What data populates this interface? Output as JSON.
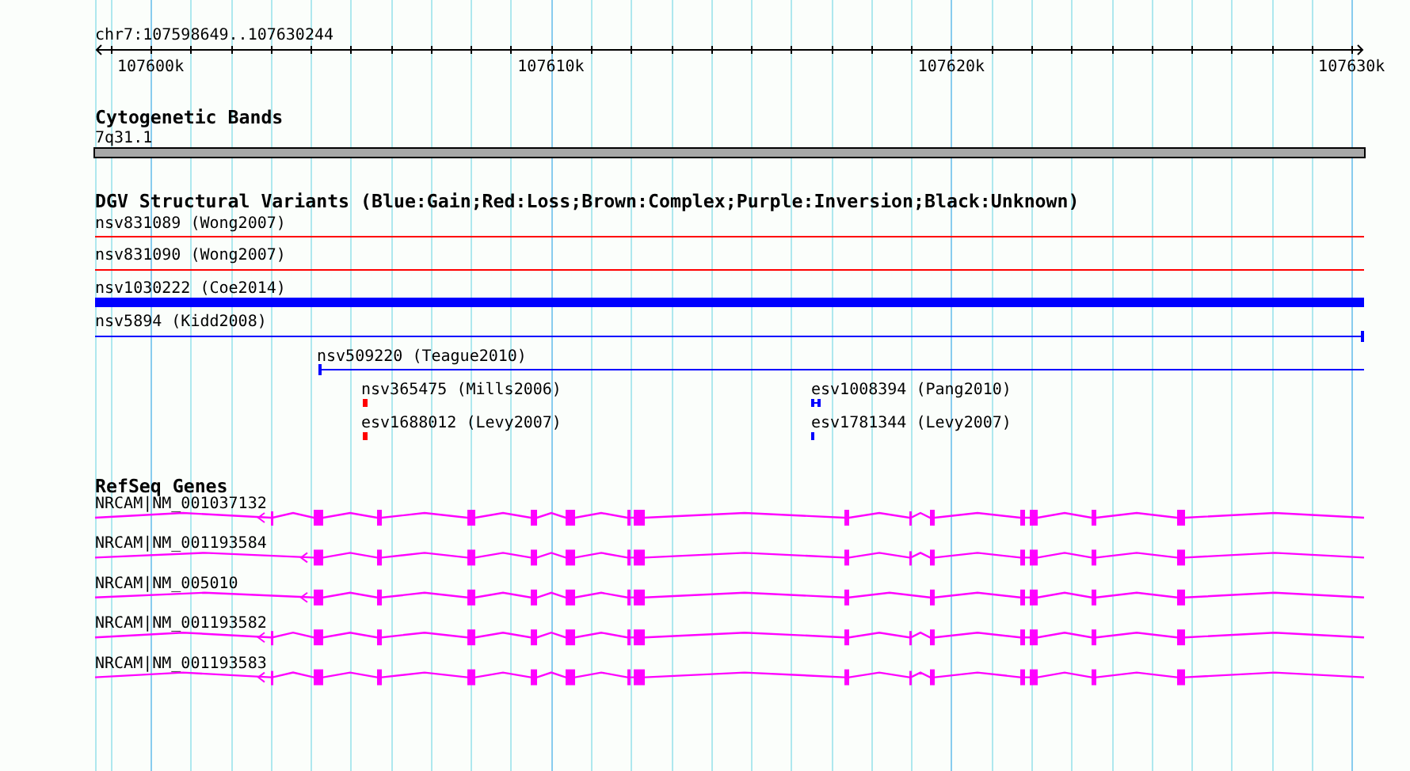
{
  "ruler": {
    "region": "chr7:107598649..107630244",
    "tick_labels": [
      "107600k",
      "107610k",
      "107620k",
      "107630k"
    ]
  },
  "cytogenetic_bands": {
    "title": "Cytogenetic Bands",
    "band": "7q31.1"
  },
  "dgv": {
    "title": "DGV Structural Variants (Blue:Gain;Red:Loss;Brown:Complex;Purple:Inversion;Black:Unknown)",
    "variants": [
      {
        "label": "nsv831089 (Wong2007)",
        "color": "#ff0000"
      },
      {
        "label": "nsv831090 (Wong2007)",
        "color": "#ff0000"
      },
      {
        "label": "nsv1030222 (Coe2014)",
        "color": "#0000ff"
      },
      {
        "label": "nsv5894 (Kidd2008)",
        "color": "#0000ff"
      },
      {
        "label": "nsv509220 (Teague2010)",
        "color": "#0000ff"
      },
      {
        "label": "nsv365475 (Mills2006)",
        "color": "#ff0000"
      },
      {
        "label": "esv1688012 (Levy2007)",
        "color": "#ff0000"
      },
      {
        "label": "esv1008394 (Pang2010)",
        "color": "#0000ff"
      },
      {
        "label": "esv1781344 (Levy2007)",
        "color": "#0000ff"
      }
    ]
  },
  "refseq": {
    "title": "RefSeq Genes",
    "transcripts": [
      {
        "label": "NRCAM|NM_001037132"
      },
      {
        "label": "NRCAM|NM_001193584"
      },
      {
        "label": "NRCAM|NM_005010"
      },
      {
        "label": "NRCAM|NM_001193582"
      },
      {
        "label": "NRCAM|NM_001193583"
      }
    ]
  }
}
